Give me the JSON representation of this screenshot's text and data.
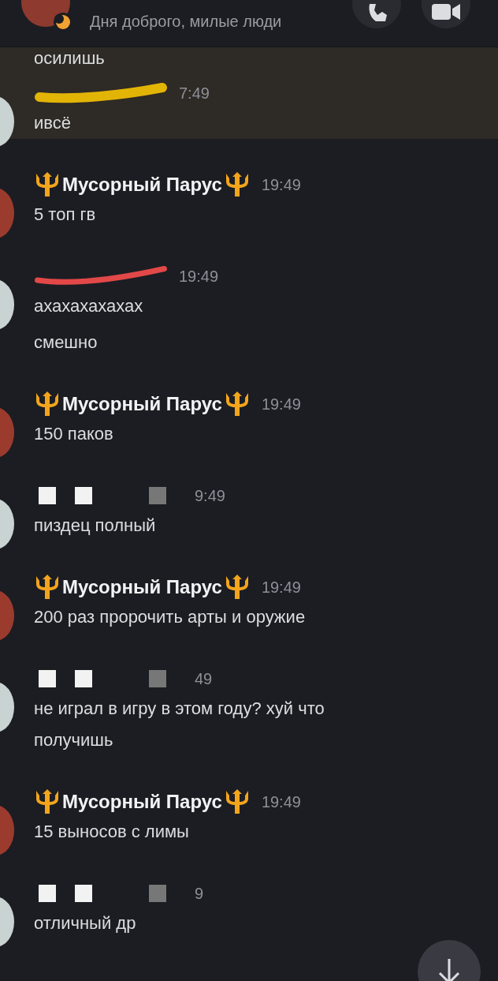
{
  "header": {
    "subtitle": "Дня доброго, милые люди"
  },
  "messages": [
    {
      "kind": "continuation",
      "highlighted": true,
      "lines": [
        "осилишь"
      ]
    },
    {
      "kind": "scribbled",
      "highlighted": true,
      "avatar": {
        "color": "#c9d3d1"
      },
      "color": "#e2b406",
      "time": "7:49",
      "lines": [
        "ивсё"
      ]
    },
    {
      "kind": "message",
      "highlighted": false,
      "avatar": {
        "color": "#9b3b2e"
      },
      "author": "Мусорный Парус",
      "time": "19:49",
      "lines": [
        "5 топ гв"
      ]
    },
    {
      "kind": "scribbled",
      "highlighted": false,
      "avatar": {
        "color": "#c9d3d1"
      },
      "color": "#e24848",
      "time": "19:49",
      "lines": [
        "ахахахахахах",
        "смешно"
      ]
    },
    {
      "kind": "message",
      "highlighted": false,
      "avatar": {
        "color": "#9b3b2e"
      },
      "author": "Мусорный Парус",
      "time": "19:49",
      "lines": [
        "150 паков"
      ]
    },
    {
      "kind": "blocked",
      "highlighted": false,
      "avatar": {
        "color": "#c9d3d1"
      },
      "time": "9:49",
      "lines": [
        "пиздец полный"
      ]
    },
    {
      "kind": "message",
      "highlighted": false,
      "avatar": {
        "color": "#9b3b2e"
      },
      "author": "Мусорный Парус",
      "time": "19:49",
      "lines": [
        "200 раз пророчить арты и оружие"
      ]
    },
    {
      "kind": "blocked",
      "highlighted": false,
      "avatar": {
        "color": "#c9d3d1"
      },
      "time": "49",
      "lines": [
        "не играл в игру в этом году? хуй что получишь"
      ]
    },
    {
      "kind": "message",
      "highlighted": false,
      "avatar": {
        "color": "#9b3b2e"
      },
      "author": "Мусорный Парус",
      "time": "19:49",
      "lines": [
        "15 выносов с лимы"
      ]
    },
    {
      "kind": "blocked",
      "highlighted": false,
      "avatar": {
        "color": "#c9d3d1"
      },
      "time": "9",
      "lines": [
        "отличный др"
      ]
    }
  ]
}
